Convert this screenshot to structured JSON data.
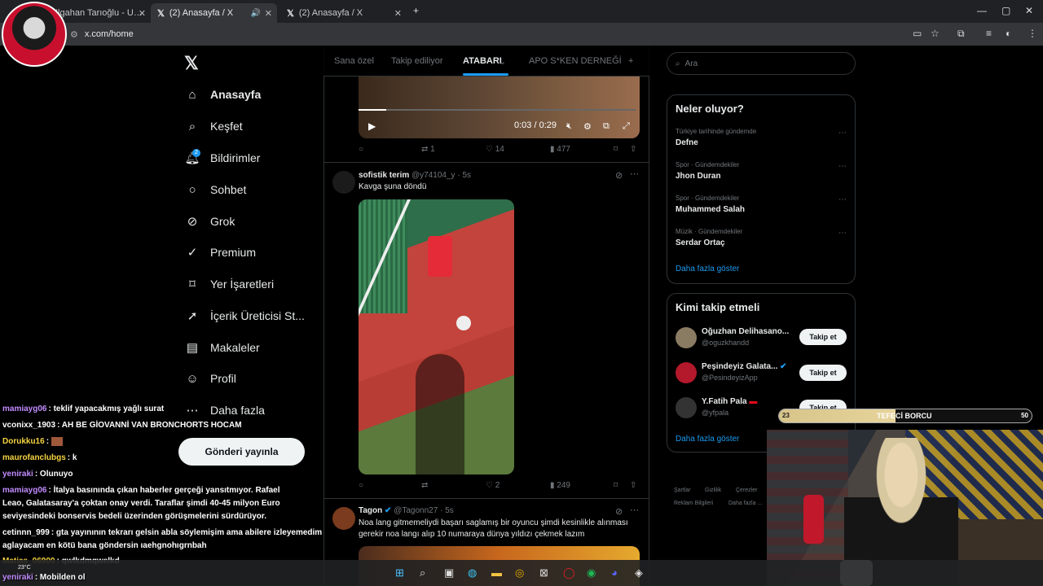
{
  "browser": {
    "tabs": [
      {
        "label": "Ilgahan Tarıoğlu - Unutma"
      },
      {
        "label": "(2) Anasayfa / X"
      },
      {
        "label": "(2) Anasayfa / X"
      }
    ],
    "url": "x.com/home"
  },
  "nav": {
    "items": [
      {
        "label": "Anasayfa",
        "icon": "home-icon"
      },
      {
        "label": "Keşfet",
        "icon": "search-icon"
      },
      {
        "label": "Bildirimler",
        "icon": "bell-icon",
        "badge": "2"
      },
      {
        "label": "Sohbet",
        "icon": "chat-icon"
      },
      {
        "label": "Grok",
        "icon": "grok-icon"
      },
      {
        "label": "Premium",
        "icon": "premium-icon"
      },
      {
        "label": "Yer İşaretleri",
        "icon": "bookmark-icon"
      },
      {
        "label": "İçerik Üreticisi St...",
        "icon": "rocket-icon"
      },
      {
        "label": "Makaleler",
        "icon": "article-icon"
      },
      {
        "label": "Profil",
        "icon": "profile-icon"
      },
      {
        "label": "Daha fazla",
        "icon": "more-icon"
      }
    ],
    "post_button": "Gönderi yayınla"
  },
  "feed": {
    "tabs": [
      "Sana özel",
      "Takip ediliyor",
      "ATABARI",
      "APO S*KEN DERNEĞİ"
    ],
    "active_tab": "ATABARI",
    "video_time": "0:03 / 0:29",
    "tweet1_actions": {
      "replies": "",
      "retweets": "1",
      "likes": "14",
      "views": "477"
    },
    "tweet2": {
      "name": "sofistik terim",
      "handle": "@y74104_y · 5s",
      "text": "Kavga şuna döndü",
      "actions": {
        "replies": "",
        "retweets": "",
        "likes": "2",
        "views": "249"
      }
    },
    "tweet3": {
      "name": "Tagon",
      "handle": "@Tagonn27 · 5s",
      "text": "Noa lang gitmemeliydi başarı saglamış bir oyuncu şimdi kesinlikle alınması gerekir noa langı alıp 10 numaraya dünya yıldızı çekmek lazım"
    }
  },
  "right": {
    "search_placeholder": "Ara",
    "trends_title": "Neler oluyor?",
    "trends": [
      {
        "category": "Türkiye tarihinde gündemde",
        "name": "Defne"
      },
      {
        "category": "Spor · Gündemdekiler",
        "name": "Jhon Duran"
      },
      {
        "category": "Spor · Gündemdekiler",
        "name": "Muhammed Salah"
      },
      {
        "category": "Müzik · Gündemdekiler",
        "name": "Serdar Ortaç"
      }
    ],
    "show_more": "Daha fazla göster",
    "follow_title": "Kimi takip etmeli",
    "follow": [
      {
        "name": "Oğuzhan Delihasano...",
        "handle": "@oguzkhandd",
        "button": "Takip et"
      },
      {
        "name": "Peşindeyiz Galata...",
        "handle": "@PesindeyizApp",
        "button": "Takip et"
      },
      {
        "name": "Y.Fatih Pala",
        "handle": "@yfpala",
        "button": "Takip et"
      }
    ],
    "follow_show_more": "Daha fazla göster",
    "footer": [
      "Şartlar",
      "Gizlilik",
      "Çerezler",
      "Reklam Bilgileri",
      "Daha fazla ..."
    ]
  },
  "chat": [
    {
      "name": "mamiayg06",
      "msg": ": teklif yapacakmış yağlı surat",
      "color": "#c18cff"
    },
    {
      "name": "vconixx_1903",
      "msg": ": AH BE GİOVANNİ VAN BRONCHORTS HOCAM",
      "color": "#ffffff"
    },
    {
      "name": "Dorukku16",
      "msg": ":",
      "color": "#f5d442"
    },
    {
      "name": "maurofanclubgs",
      "msg": ": k",
      "color": "#f5d442"
    },
    {
      "name": "yeniraki",
      "msg": ": Olunuyo",
      "color": "#c18cff"
    },
    {
      "name": "mamiayg06",
      "msg": ": İtalya basınında çıkan haberler gerçeği yansıtmıyor. Rafael",
      "color": "#c18cff"
    },
    {
      "name": "",
      "msg": "Leao, Galatasaray'a çoktan onay verdi. Taraflar şimdi 40-45 milyon Euro",
      "color": "#ffffff"
    },
    {
      "name": "",
      "msg": "seviyesindeki bonservis bedeli üzerinden görüşmelerini sürdürüyor.",
      "color": "#ffffff"
    },
    {
      "name": "cetinnn_999",
      "msg": ": gta yayınının tekrarı gelsin abla söylemişim ama abilere izleyemedim",
      "color": "#ffffff"
    },
    {
      "name": "",
      "msg": "aglayacam en kötü bana göndersin ıaehgnohıgrnbah",
      "color": "#ffffff"
    },
    {
      "name": "Matias_06900",
      "msg": ": qwlkdmqwelkd",
      "color": "#f5d442"
    },
    {
      "name": "yeniraki",
      "msg": ": Mobilden ol",
      "color": "#c18cff"
    }
  ],
  "goal": {
    "current": "23",
    "title": "TEFECİ BORCU",
    "max": "50",
    "progress": 0.46
  },
  "taskbar": {
    "weather": "23°C"
  }
}
